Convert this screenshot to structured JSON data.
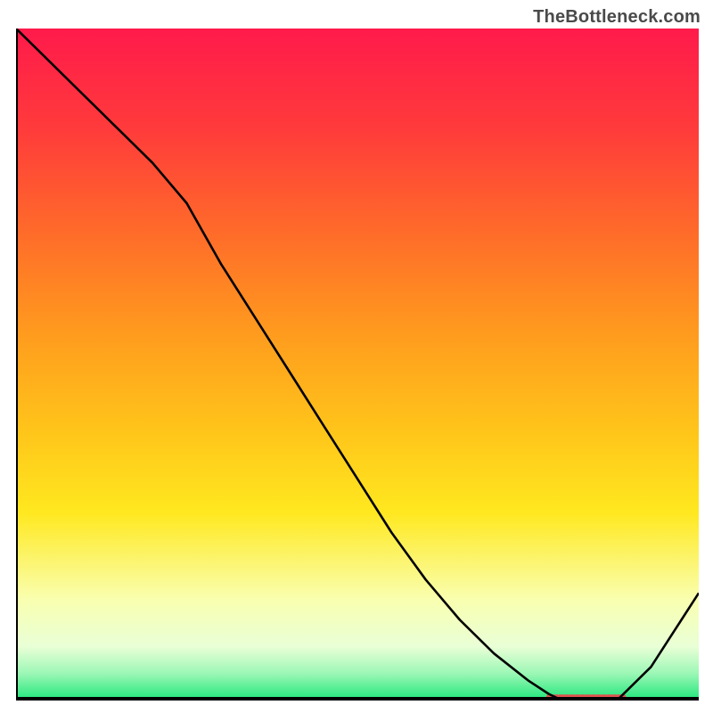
{
  "watermark": "TheBottleneck.com",
  "chart_data": {
    "type": "line",
    "title": "",
    "xlabel": "",
    "ylabel": "",
    "xlim": [
      0,
      100
    ],
    "ylim": [
      0,
      100
    ],
    "x": [
      0,
      5,
      10,
      15,
      20,
      25,
      30,
      35,
      40,
      45,
      50,
      55,
      60,
      65,
      70,
      75,
      78,
      80,
      82,
      85,
      88,
      90,
      93,
      100
    ],
    "values": [
      100,
      95,
      90,
      85,
      80,
      74,
      65,
      57,
      49,
      41,
      33,
      25,
      18,
      12,
      7,
      3,
      1,
      0,
      0,
      0,
      0,
      2,
      5,
      16
    ],
    "highlight_x_range": [
      78,
      89
    ],
    "background": {
      "type": "vertical_gradient",
      "stops": [
        {
          "offset": 0.0,
          "color": "#ff1a4b"
        },
        {
          "offset": 0.15,
          "color": "#ff3b3b"
        },
        {
          "offset": 0.3,
          "color": "#ff6a2a"
        },
        {
          "offset": 0.45,
          "color": "#ff9a1e"
        },
        {
          "offset": 0.6,
          "color": "#ffc51a"
        },
        {
          "offset": 0.72,
          "color": "#ffe81f"
        },
        {
          "offset": 0.85,
          "color": "#f9ffb0"
        },
        {
          "offset": 0.92,
          "color": "#e9ffd6"
        },
        {
          "offset": 0.96,
          "color": "#9bf7b5"
        },
        {
          "offset": 1.0,
          "color": "#1ee67a"
        }
      ]
    }
  }
}
